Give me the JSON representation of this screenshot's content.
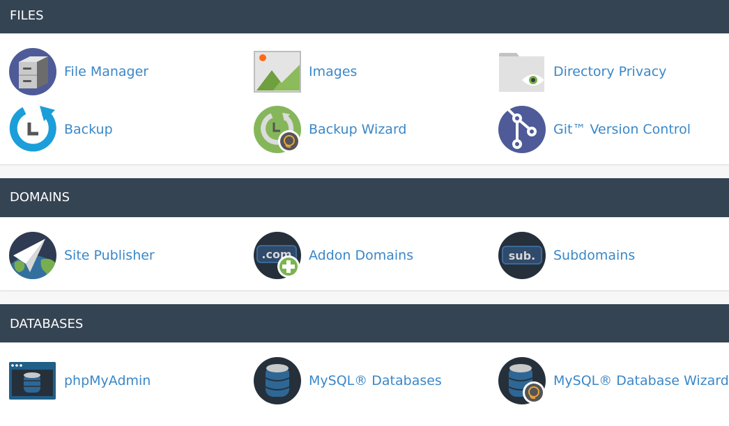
{
  "sections": [
    {
      "title": "FILES",
      "items": [
        {
          "label": "File Manager",
          "icon": "file-cabinet-icon"
        },
        {
          "label": "Images",
          "icon": "image-icon"
        },
        {
          "label": "Directory Privacy",
          "icon": "folder-eye-icon"
        },
        {
          "label": "Backup",
          "icon": "backup-clock-icon"
        },
        {
          "label": "Backup Wizard",
          "icon": "backup-wizard-icon"
        },
        {
          "label": "Git™ Version Control",
          "icon": "git-branch-icon"
        }
      ]
    },
    {
      "title": "DOMAINS",
      "items": [
        {
          "label": "Site Publisher",
          "icon": "paper-plane-globe-icon"
        },
        {
          "label": "Addon Domains",
          "icon": "com-plus-icon",
          "icon_text": ".com"
        },
        {
          "label": "Subdomains",
          "icon": "sub-domain-icon",
          "icon_text": "sub."
        }
      ]
    },
    {
      "title": "DATABASES",
      "items": [
        {
          "label": "phpMyAdmin",
          "icon": "database-window-icon"
        },
        {
          "label": "MySQL® Databases",
          "icon": "database-icon"
        },
        {
          "label": "MySQL® Database Wizard",
          "icon": "database-wizard-icon"
        }
      ]
    }
  ],
  "colors": {
    "header_bg": "#354453",
    "link": "#3a87c8",
    "page_bg": "#f7f7f7"
  }
}
